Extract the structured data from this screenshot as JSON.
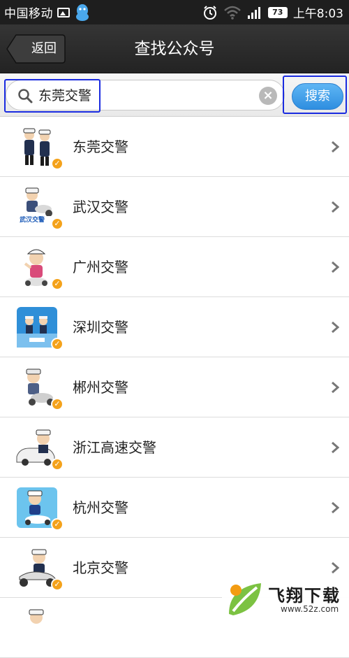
{
  "status_bar": {
    "carrier": "中国移动",
    "battery": "73",
    "time": "上午8:03"
  },
  "nav": {
    "back_label": "返回",
    "title": "查找公众号"
  },
  "search": {
    "value": "东莞交警",
    "button_label": "搜索"
  },
  "results": [
    {
      "name": "东莞交警",
      "avatar_icon": "traffic-police-duo-avatar"
    },
    {
      "name": "武汉交警",
      "avatar_icon": "traffic-police-motorbike-avatar"
    },
    {
      "name": "广州交警",
      "avatar_icon": "traffic-police-salute-avatar"
    },
    {
      "name": "深圳交警",
      "avatar_icon": "traffic-police-blue-card-avatar"
    },
    {
      "name": "郴州交警",
      "avatar_icon": "traffic-police-scooter-avatar"
    },
    {
      "name": "浙江高速交警",
      "avatar_icon": "traffic-police-car-avatar"
    },
    {
      "name": "杭州交警",
      "avatar_icon": "traffic-police-blue-scooter-avatar"
    },
    {
      "name": "北京交警",
      "avatar_icon": "traffic-police-motorcycle-avatar"
    }
  ],
  "watermark": {
    "brand": "飞翔下载",
    "url": "www.52z.com"
  },
  "colors": {
    "nav_bg": "#2b2b2b",
    "search_button": "#3a9be8",
    "highlight": "#1a2be0",
    "verified_badge": "#f4a21b"
  }
}
